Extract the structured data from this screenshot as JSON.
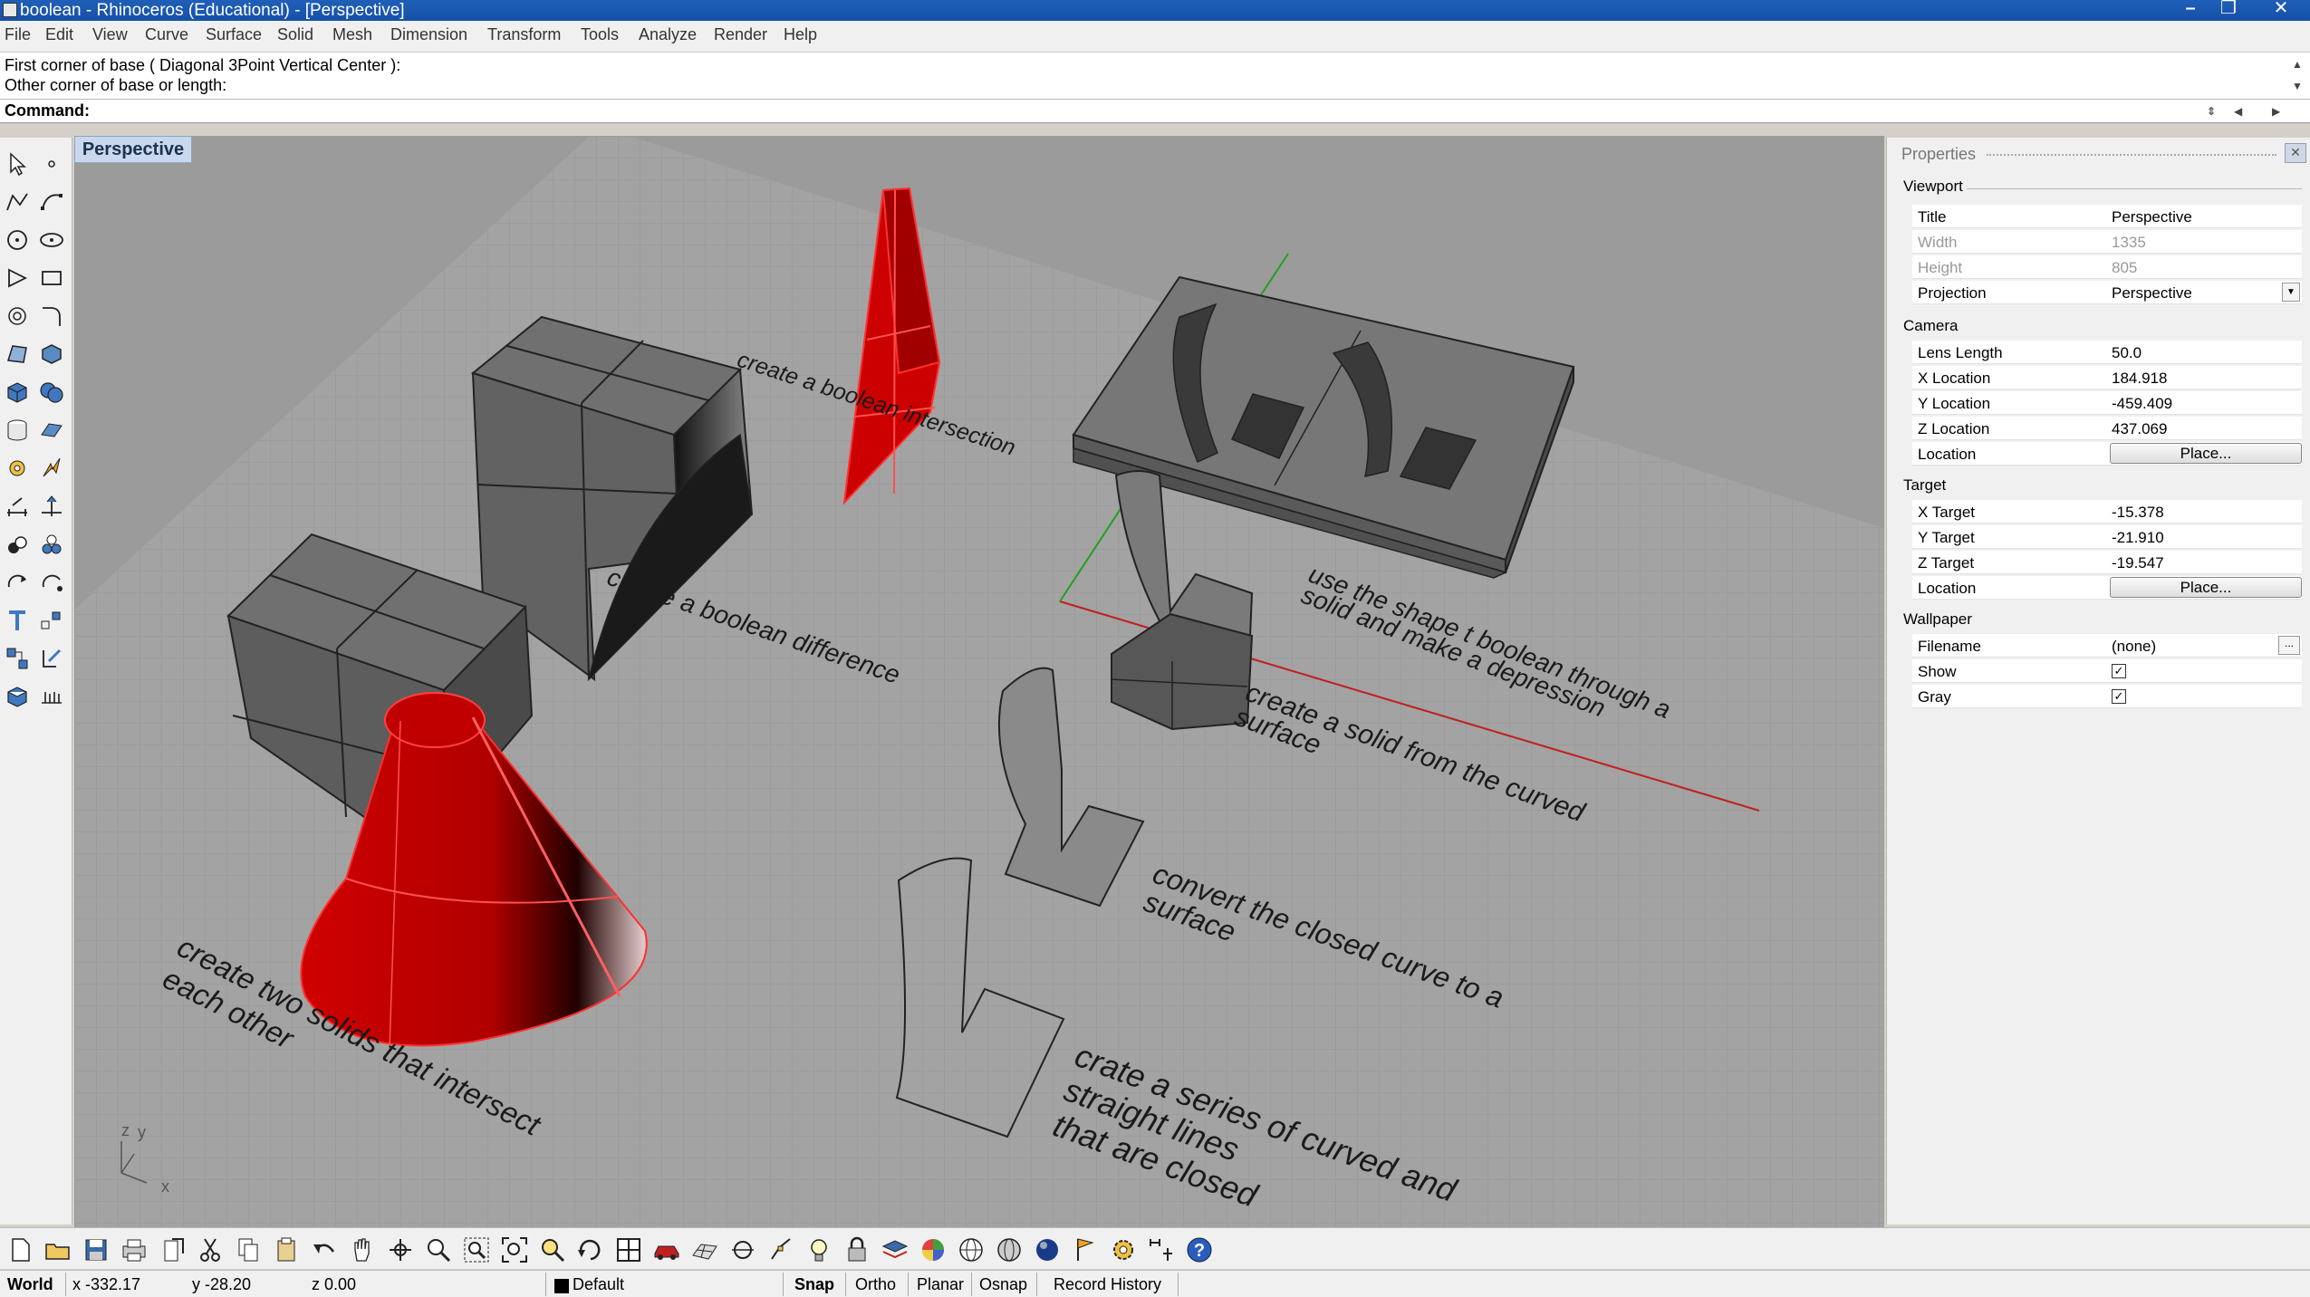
{
  "window": {
    "title": "boolean - Rhinoceros (Educational) - [Perspective]",
    "controls": {
      "minimize": "–",
      "restore": "❐",
      "close": "✕"
    }
  },
  "menu": [
    "File",
    "Edit",
    "View",
    "Curve",
    "Surface",
    "Solid",
    "Mesh",
    "Dimension",
    "Transform",
    "Tools",
    "Analyze",
    "Render",
    "Help"
  ],
  "command": {
    "history": [
      "First corner of base ( Diagonal  3Point  Vertical  Center ):",
      "Other corner of base or length:"
    ],
    "prompt_label": "Command:"
  },
  "viewport": {
    "tab_label": "Perspective",
    "axis_labels": {
      "z": "z",
      "y": "y",
      "x": "x"
    },
    "annotations": [
      "create a boolean intersection",
      "create a boolean difference",
      "use the shape t boolean through a",
      "solid and make a depression",
      "create a solid from the curved",
      "surface",
      "convert the closed curve to a",
      "surface",
      "create two solids that intersect",
      "each other",
      "crate a series of curved and",
      "straight lines",
      "that are closed"
    ]
  },
  "properties": {
    "panel_title": "Properties",
    "close_glyph": "✕",
    "sections": {
      "viewport": "Viewport",
      "camera": "Camera",
      "target": "Target",
      "wallpaper": "Wallpaper"
    },
    "viewport_rows": [
      {
        "name": "Title",
        "value": "Perspective"
      },
      {
        "name": "Width",
        "value": "1335"
      },
      {
        "name": "Height",
        "value": "805"
      },
      {
        "name": "Projection",
        "value": "Perspective"
      }
    ],
    "camera_rows": [
      {
        "name": "Lens Length",
        "value": "50.0"
      },
      {
        "name": "X Location",
        "value": "184.918"
      },
      {
        "name": "Y Location",
        "value": "-459.409"
      },
      {
        "name": "Z Location",
        "value": "437.069"
      },
      {
        "name": "Location",
        "value": "Place..."
      }
    ],
    "target_rows": [
      {
        "name": "X Target",
        "value": "-15.378"
      },
      {
        "name": "Y Target",
        "value": "-21.910"
      },
      {
        "name": "Z Target",
        "value": "-19.547"
      },
      {
        "name": "Location",
        "value": "Place..."
      }
    ],
    "wallpaper_rows": [
      {
        "name": "Filename",
        "value": "(none)"
      },
      {
        "name": "Show",
        "value": "✓"
      },
      {
        "name": "Gray",
        "value": "✓"
      }
    ]
  },
  "status": {
    "cplane": "World",
    "x": "x -332.17",
    "y": "y -28.20",
    "z": "z 0.00",
    "layer": "Default",
    "snap": "Snap",
    "ortho": "Ortho",
    "planar": "Planar",
    "osnap": "Osnap",
    "record_history": "Record History"
  },
  "colors": {
    "selected_object": "#e00000",
    "viewport_bg": "#9b9b9b",
    "title_bar": "#1f5fb8"
  }
}
